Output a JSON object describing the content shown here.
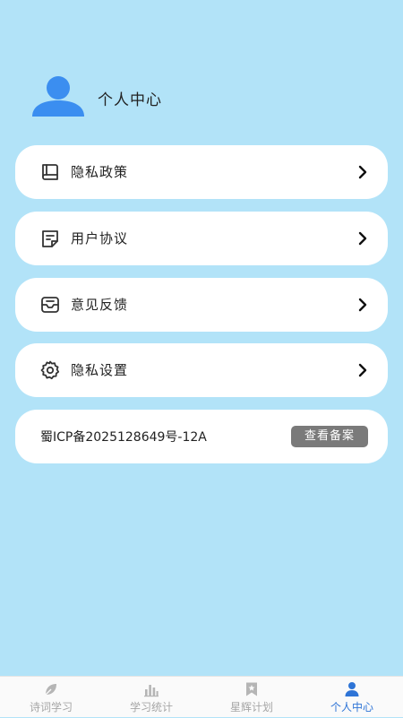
{
  "header": {
    "title": "个人中心"
  },
  "menu": {
    "items": [
      {
        "label": "隐私政策",
        "icon": "book-icon"
      },
      {
        "label": "用户协议",
        "icon": "document-icon"
      },
      {
        "label": "意见反馈",
        "icon": "inbox-icon"
      },
      {
        "label": "隐私设置",
        "icon": "gear-icon"
      }
    ]
  },
  "icp": {
    "number": "蜀ICP备2025128649号-12A",
    "button_label": "查看备案"
  },
  "tabbar": {
    "tabs": [
      {
        "label": "诗词学习",
        "icon": "leaf-icon",
        "active": false
      },
      {
        "label": "学习统计",
        "icon": "bar-chart-icon",
        "active": false
      },
      {
        "label": "星辉计划",
        "icon": "star-bookmark-icon",
        "active": false
      },
      {
        "label": "个人中心",
        "icon": "person-icon",
        "active": true
      }
    ]
  },
  "colors": {
    "background": "#b2e3f8",
    "card": "#ffffff",
    "accent": "#2e74d6",
    "avatar": "#3b8ef0",
    "icp_button": "#7a7a7a",
    "tab_inactive": "#a6a6a6"
  }
}
